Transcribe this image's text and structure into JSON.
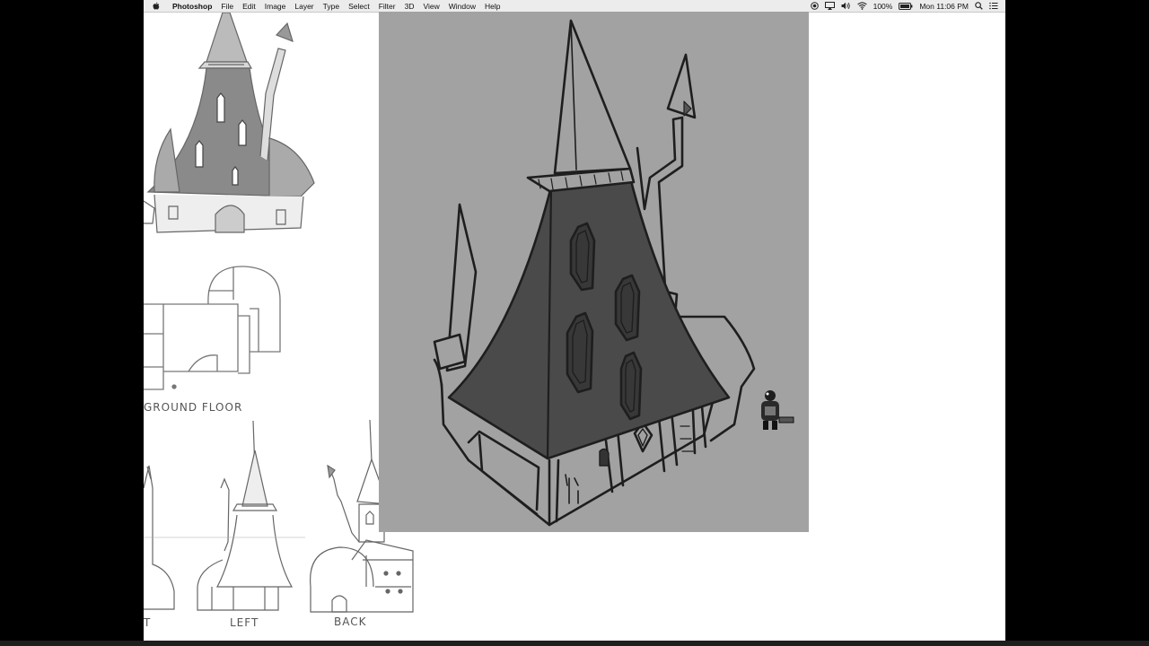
{
  "menubar": {
    "app_name": "Photoshop",
    "menus": [
      "File",
      "Edit",
      "Image",
      "Layer",
      "Type",
      "Select",
      "Filter",
      "3D",
      "View",
      "Window",
      "Help"
    ],
    "battery": "100%",
    "clock": "Mon 11:06 PM"
  },
  "reference": {
    "floor_label": "GROUND FLOOR",
    "left_label": "LEFT",
    "back_label": "BACK",
    "front_label_partial": "T"
  },
  "colors": {
    "canvas_bg": "#a2a2a2",
    "roof_fill": "#4a4a4a",
    "line": "#1e1e1e",
    "screen_bg": "#ffffff"
  }
}
